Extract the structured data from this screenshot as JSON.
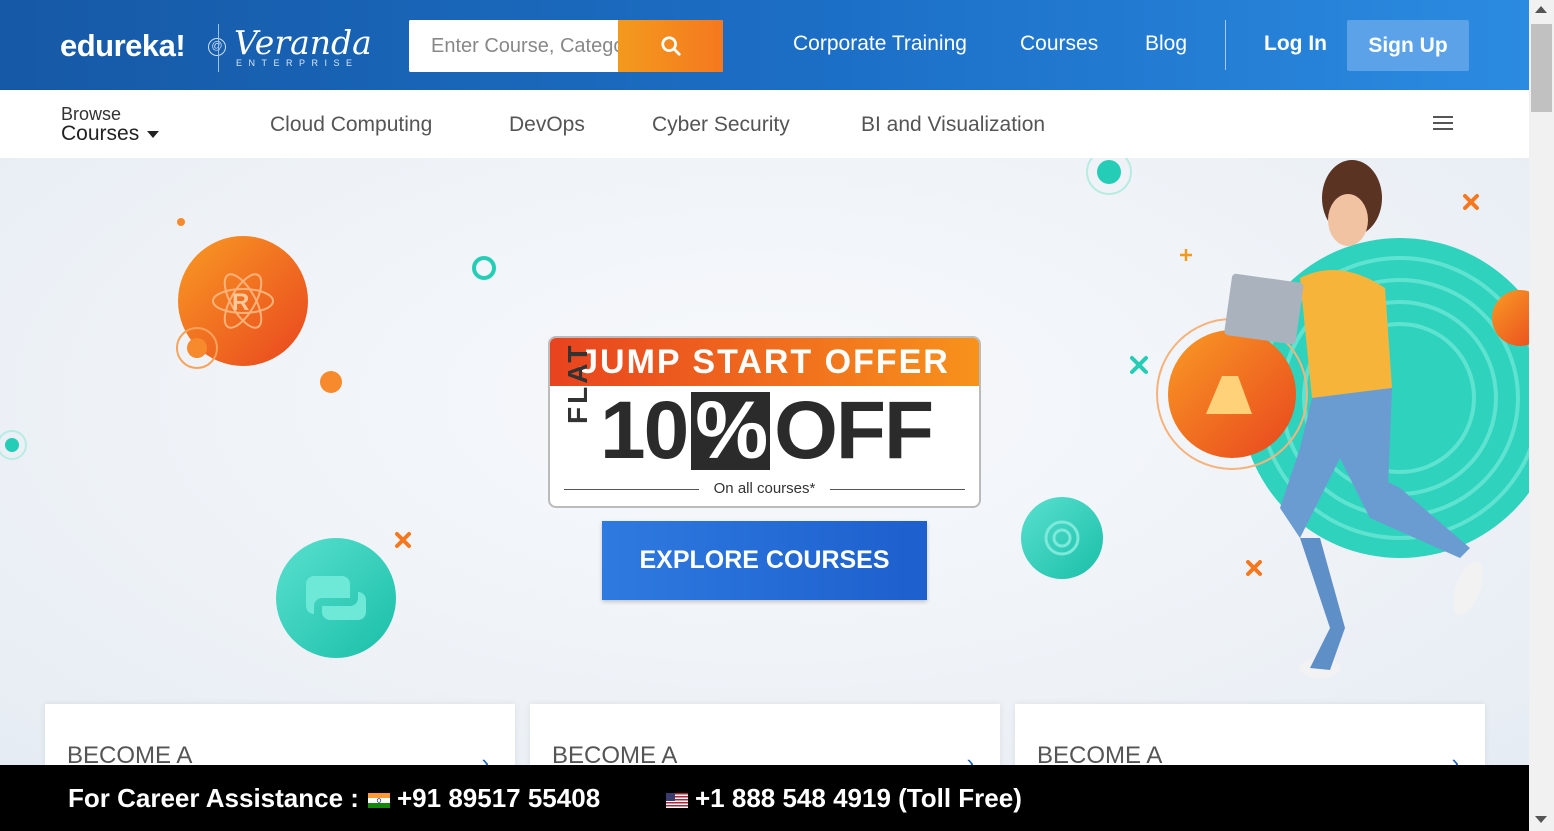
{
  "header": {
    "logo_text": "edureka!",
    "logo_at": "@",
    "partner_logo": "Veranda",
    "partner_sub": "ENTERPRISE",
    "search_placeholder": "Enter Course, Category or keyword",
    "search_icon": "search-icon",
    "nav": {
      "corporate_training": "Corporate Training",
      "courses": "Courses",
      "blog": "Blog",
      "login": "Log In",
      "signup": "Sign Up"
    }
  },
  "subnav": {
    "browse_small": "Browse",
    "browse_big": "Courses",
    "categories": [
      "Cloud Computing",
      "DevOps",
      "Cyber Security",
      "BI and Visualization"
    ],
    "menu_icon": "hamburger-menu-icon"
  },
  "hero": {
    "offer_title": "JUMP START OFFER",
    "offer_flat": "FLAT",
    "offer_number": "10",
    "offer_percent": "%",
    "offer_off": "OFF",
    "offer_note": "On all courses*",
    "cta": "EXPLORE COURSES",
    "decor_icons": [
      "r-language-icon",
      "python-icon",
      "openai-icon",
      "azure-icon"
    ],
    "accent_orange": "#f5781f",
    "accent_teal": "#26cdb6",
    "accent_blue": "#1d5fcd"
  },
  "cards": [
    {
      "title": "BECOME A"
    },
    {
      "title": "BECOME A"
    },
    {
      "title": "BECOME A"
    }
  ],
  "footer_bar": {
    "label": "For Career Assistance :",
    "phone_india": "+91 89517 55408",
    "phone_us": "+1 888 548 4919 (Toll Free)"
  }
}
